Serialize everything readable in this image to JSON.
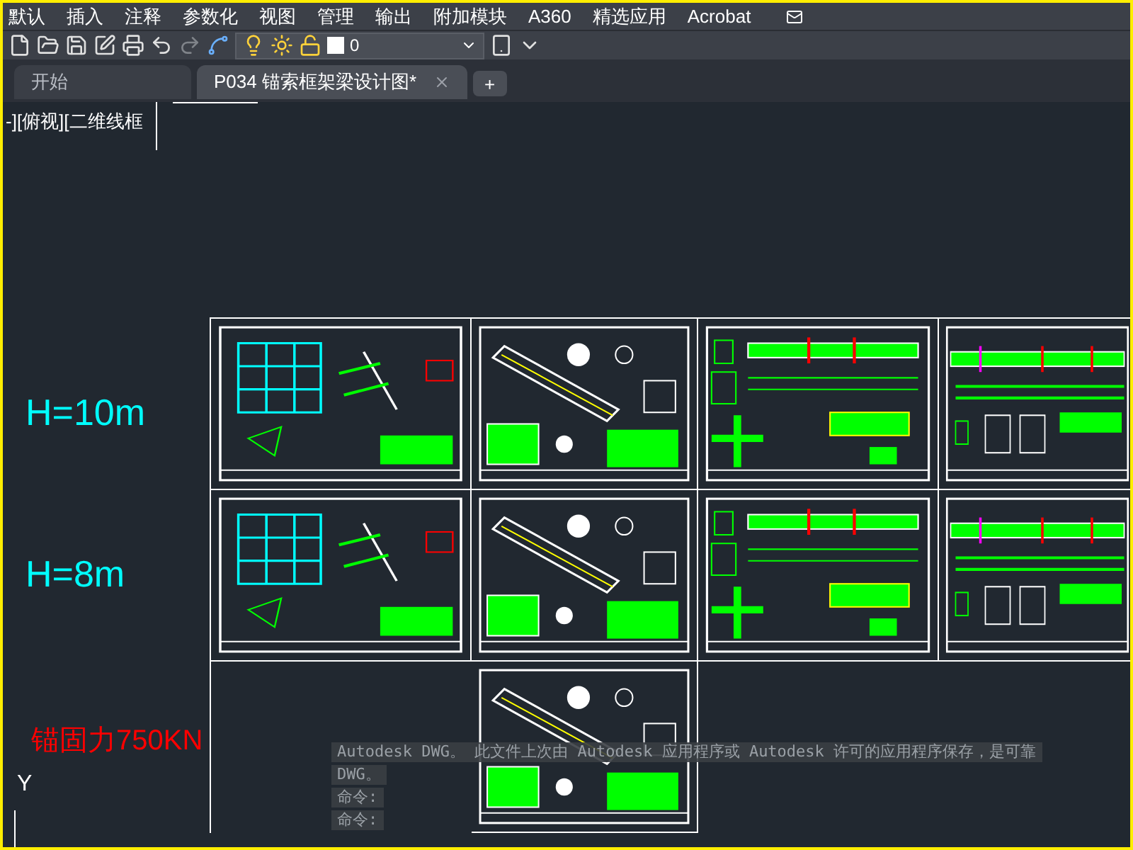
{
  "menu": [
    "默认",
    "插入",
    "注释",
    "参数化",
    "视图",
    "管理",
    "输出",
    "附加模块",
    "A360",
    "精选应用",
    "Acrobat"
  ],
  "toolbar": {
    "layer": "0"
  },
  "tabs": [
    {
      "label": "开始",
      "selected": false
    },
    {
      "label": "P034 锚索框架梁设计图*",
      "selected": true
    }
  ],
  "new_tab": "+",
  "viewport_label": "-][俯视][二维线框",
  "canvas_texts": [
    {
      "kind": "height",
      "text": "H=10m"
    },
    {
      "kind": "height",
      "text": "H=8m"
    },
    {
      "kind": "note",
      "text": "锚固力750KN"
    },
    {
      "kind": "axis",
      "text": "Y"
    }
  ],
  "sheets": [
    {
      "kind": "frame"
    },
    {
      "kind": "anchor"
    },
    {
      "kind": "beam"
    },
    {
      "kind": "longbeam"
    },
    {
      "kind": "frame"
    },
    {
      "kind": "anchor"
    },
    {
      "kind": "beam"
    },
    {
      "kind": "longbeam"
    },
    {
      "kind": "anchor"
    }
  ],
  "command_history": [
    "Autodesk DWG。  此文件上次由 Autodesk 应用程序或 Autodesk 许可的应用程序保存，是可靠",
    "DWG。",
    "命令:",
    "命令:"
  ]
}
